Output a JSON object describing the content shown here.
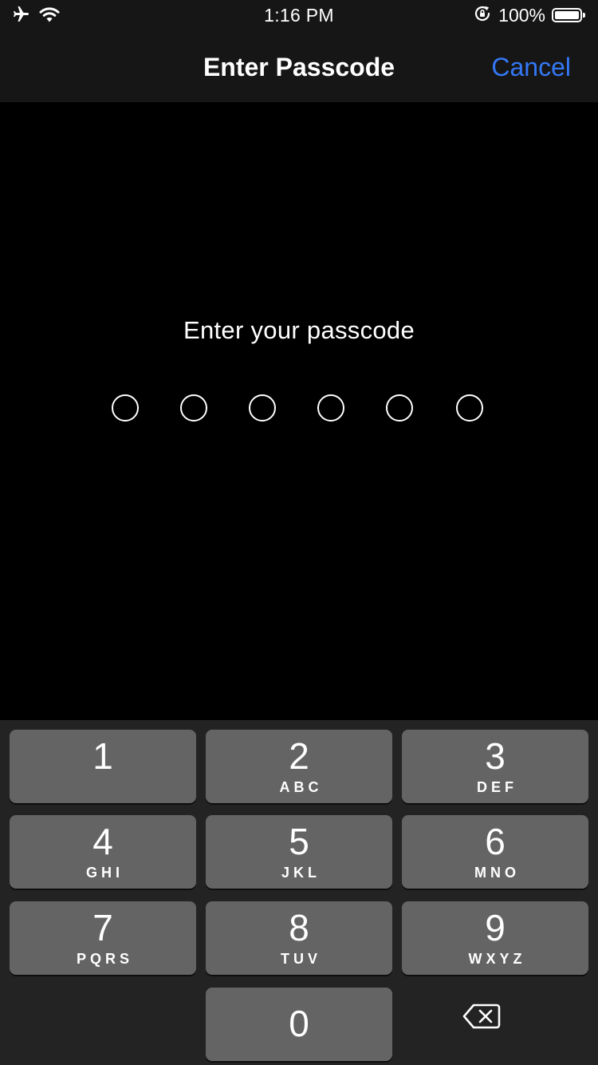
{
  "status_bar": {
    "time": "1:16 PM",
    "battery_percent": "100%",
    "battery_level": 1.0,
    "icons": [
      "airplane-icon",
      "wifi-icon",
      "orientation-lock-icon",
      "battery-icon"
    ]
  },
  "nav": {
    "title": "Enter Passcode",
    "cancel_label": "Cancel"
  },
  "prompt": "Enter your passcode",
  "passcode": {
    "length": 6,
    "filled": 0
  },
  "keypad": {
    "keys": [
      {
        "digit": "1",
        "letters": ""
      },
      {
        "digit": "2",
        "letters": "ABC"
      },
      {
        "digit": "3",
        "letters": "DEF"
      },
      {
        "digit": "4",
        "letters": "GHI"
      },
      {
        "digit": "5",
        "letters": "JKL"
      },
      {
        "digit": "6",
        "letters": "MNO"
      },
      {
        "digit": "7",
        "letters": "PQRS"
      },
      {
        "digit": "8",
        "letters": "TUV"
      },
      {
        "digit": "9",
        "letters": "WXYZ"
      },
      {
        "digit": "0",
        "letters": ""
      }
    ],
    "delete_icon": "delete-backspace-icon"
  },
  "colors": {
    "accent": "#3478f6",
    "background": "#000000",
    "header": "#161616",
    "keypad_background": "#232323",
    "key": "#646464",
    "text": "#ffffff"
  }
}
